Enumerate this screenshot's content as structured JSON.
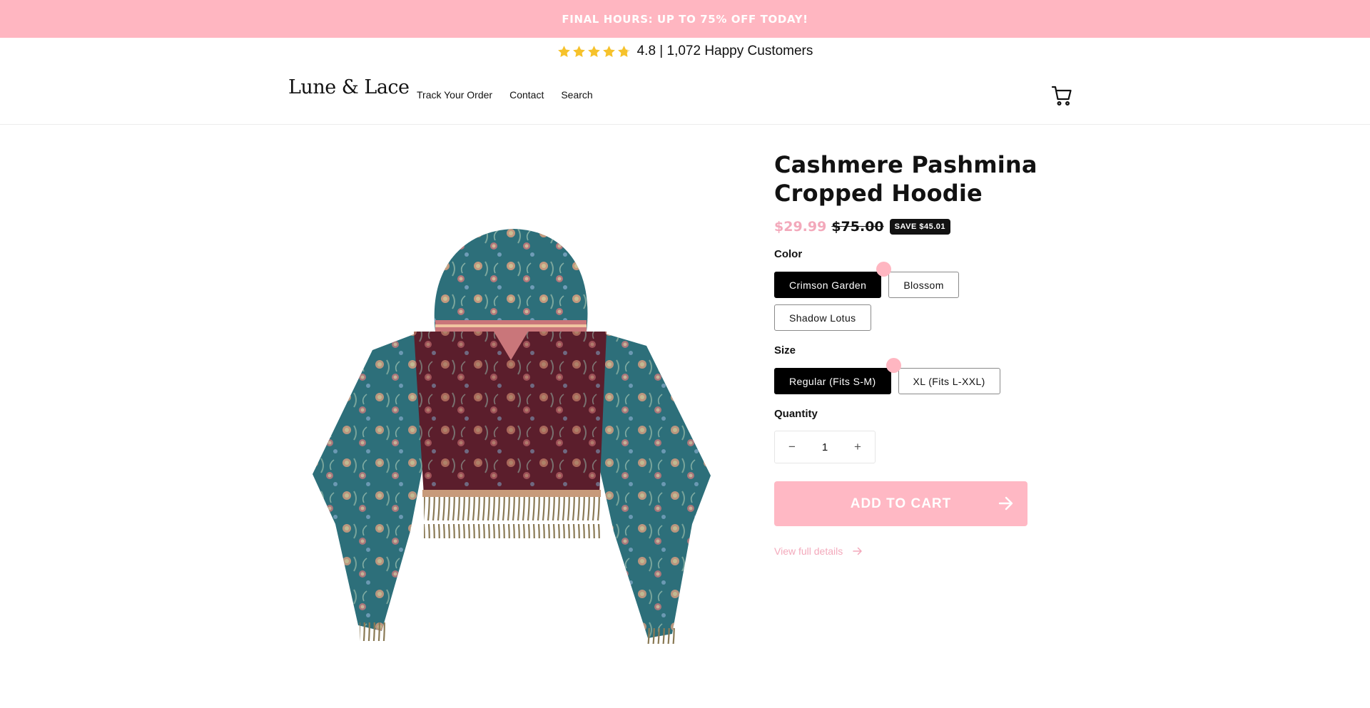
{
  "colors": {
    "accent": "#ffb6c1",
    "text": "#121212",
    "button_selected": "#000000",
    "price_sale": "#f3a9bb",
    "star": "#f6c22b",
    "atc_button": "#ffb8c4",
    "link": "#f3a9bb"
  },
  "announcement": {
    "text": "FINAL HOURS: UP TO 75% OFF TODAY!"
  },
  "rating": {
    "stars": 4.8,
    "text": "4.8 | 1,072 Happy Customers",
    "icon": "star-icon"
  },
  "header": {
    "logo": "Lune & Lace",
    "nav": [
      "Track Your Order",
      "Contact",
      "Search"
    ],
    "cart_icon": "cart-icon"
  },
  "product": {
    "title": "Cashmere Pashmina Cropped Hoodie",
    "price_sale": "$29.99",
    "price_regular": "$75.00",
    "save_badge": "SAVE $45.01",
    "color_label": "Color",
    "colors": [
      "Crimson Garden",
      "Blossom",
      "Shadow Lotus"
    ],
    "selected_color": "Crimson Garden",
    "size_label": "Size",
    "sizes": [
      "Regular (Fits S-M)",
      "XL (Fits L-XXL)"
    ],
    "selected_size": "Regular (Fits S-M)",
    "quantity_label": "Quantity",
    "quantity": "1",
    "qty_minus": "−",
    "qty_plus": "+",
    "add_to_cart": "ADD TO CART",
    "view_details": "View full details"
  }
}
